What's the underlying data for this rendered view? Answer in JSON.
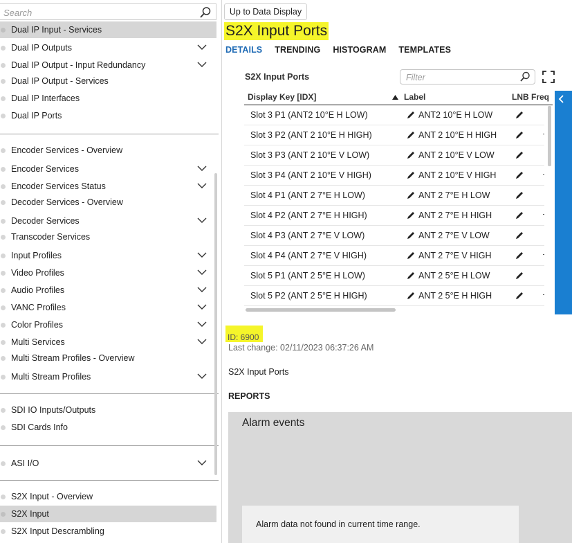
{
  "sidebar": {
    "search_placeholder": "Search",
    "items": [
      {
        "label": "Dual IP Input - Services",
        "active": true,
        "chevron": false
      },
      {
        "label": "Dual IP Outputs",
        "active": false,
        "chevron": true
      },
      {
        "label": "Dual IP Output - Input Redundancy",
        "active": false,
        "chevron": true
      },
      {
        "label": "Dual IP Output - Services",
        "active": false,
        "chevron": false
      },
      {
        "label": "Dual IP Interfaces",
        "active": false,
        "chevron": false
      },
      {
        "label": "Dual IP Ports",
        "active": false,
        "chevron": false
      },
      {
        "label": "Encoder Services - Overview",
        "active": false,
        "chevron": false
      },
      {
        "label": "Encoder Services",
        "active": false,
        "chevron": true
      },
      {
        "label": "Encoder Services Status",
        "active": false,
        "chevron": true
      },
      {
        "label": "Decoder Services - Overview",
        "active": false,
        "chevron": false
      },
      {
        "label": "Decoder Services",
        "active": false,
        "chevron": true
      },
      {
        "label": "Transcoder Services",
        "active": false,
        "chevron": false
      },
      {
        "label": "Input Profiles",
        "active": false,
        "chevron": true
      },
      {
        "label": "Video Profiles",
        "active": false,
        "chevron": true
      },
      {
        "label": "Audio Profiles",
        "active": false,
        "chevron": true
      },
      {
        "label": "VANC Profiles",
        "active": false,
        "chevron": true
      },
      {
        "label": "Color Profiles",
        "active": false,
        "chevron": true
      },
      {
        "label": "Multi Services",
        "active": false,
        "chevron": true
      },
      {
        "label": "Multi Stream Profiles - Overview",
        "active": false,
        "chevron": false
      },
      {
        "label": "Multi Stream Profiles",
        "active": false,
        "chevron": true
      },
      {
        "label": "SDI IO Inputs/Outputs",
        "active": false,
        "chevron": false
      },
      {
        "label": "SDI Cards Info",
        "active": false,
        "chevron": false
      },
      {
        "label": "ASI I/O",
        "active": false,
        "chevron": true
      },
      {
        "label": "S2X Input - Overview",
        "active": false,
        "chevron": false
      },
      {
        "label": "S2X Input",
        "active": true,
        "chevron": false
      },
      {
        "label": "S2X Input Descrambling",
        "active": false,
        "chevron": false
      }
    ]
  },
  "main": {
    "up_button": "Up to Data Display",
    "title": "S2X Input Ports",
    "tabs": [
      "DETAILS",
      "TRENDING",
      "HISTOGRAM",
      "TEMPLATES"
    ],
    "active_tab": "DETAILS",
    "table": {
      "title": "S2X Input Ports",
      "filter_placeholder": "Filter",
      "columns": [
        "Display Key [IDX]",
        "Label",
        "LNB Freq"
      ],
      "rows": [
        {
          "key": "Slot 3 P1 (ANT2 10°E H LOW)",
          "label": "ANT2 10°E H LOW",
          "extra": false
        },
        {
          "key": "Slot 3 P2 (ANT 2 10°E H HIGH)",
          "label": "ANT 2 10°E H HIGH",
          "extra": true
        },
        {
          "key": "Slot 3 P3 (ANT 2 10°E V LOW)",
          "label": "ANT 2 10°E V LOW",
          "extra": false
        },
        {
          "key": "Slot 3 P4 (ANT 2 10°E V HIGH)",
          "label": "ANT 2 10°E V HIGH",
          "extra": true
        },
        {
          "key": "Slot 4 P1 (ANT 2 7°E H LOW)",
          "label": "ANT 2 7°E H LOW",
          "extra": false
        },
        {
          "key": "Slot 4 P2 (ANT 2 7°E H HIGH)",
          "label": "ANT 2 7°E H HIGH",
          "extra": true
        },
        {
          "key": "Slot 4 P3 (ANT 2 7°E V LOW)",
          "label": "ANT 2 7°E V LOW",
          "extra": false
        },
        {
          "key": "Slot 4 P4 (ANT 2 7°E V HIGH)",
          "label": "ANT 2 7°E V HIGH",
          "extra": true
        },
        {
          "key": "Slot 5 P1 (ANT 2 5°E H LOW)",
          "label": "ANT 2 5°E H LOW",
          "extra": false
        },
        {
          "key": "Slot 5 P2 (ANT 2 5°E H HIGH)",
          "label": "ANT 2 5°E H HIGH",
          "extra": true
        }
      ]
    },
    "id_text": "ID: 6900",
    "last_change": "Last change: 02/11/2023 06:37:26 AM",
    "description": "S2X Input Ports",
    "reports_label": "REPORTS",
    "alarm_title": "Alarm events",
    "alarm_message": "Alarm data not found in current time range."
  },
  "colors": {
    "accent": "#1a7fd1",
    "highlight": "#f5f52a",
    "active_row": "#d6d6d6"
  },
  "icons": [
    "search-icon",
    "chevron-down-icon",
    "filter-search-icon",
    "expand-icon",
    "sort-up-icon",
    "pencil-icon",
    "collapse-arrow-icon"
  ]
}
